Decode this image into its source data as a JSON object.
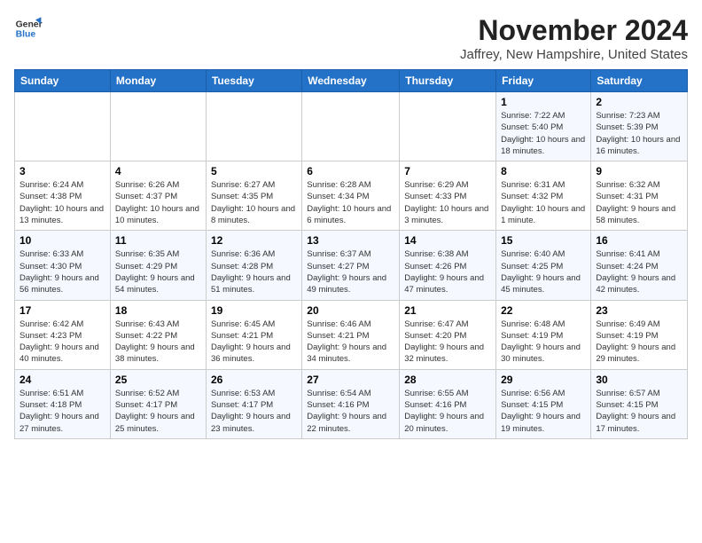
{
  "header": {
    "logo_line1": "General",
    "logo_line2": "Blue",
    "month": "November 2024",
    "location": "Jaffrey, New Hampshire, United States"
  },
  "weekdays": [
    "Sunday",
    "Monday",
    "Tuesday",
    "Wednesday",
    "Thursday",
    "Friday",
    "Saturday"
  ],
  "weeks": [
    [
      {
        "day": "",
        "detail": ""
      },
      {
        "day": "",
        "detail": ""
      },
      {
        "day": "",
        "detail": ""
      },
      {
        "day": "",
        "detail": ""
      },
      {
        "day": "",
        "detail": ""
      },
      {
        "day": "1",
        "detail": "Sunrise: 7:22 AM\nSunset: 5:40 PM\nDaylight: 10 hours and 18 minutes."
      },
      {
        "day": "2",
        "detail": "Sunrise: 7:23 AM\nSunset: 5:39 PM\nDaylight: 10 hours and 16 minutes."
      }
    ],
    [
      {
        "day": "3",
        "detail": "Sunrise: 6:24 AM\nSunset: 4:38 PM\nDaylight: 10 hours and 13 minutes."
      },
      {
        "day": "4",
        "detail": "Sunrise: 6:26 AM\nSunset: 4:37 PM\nDaylight: 10 hours and 10 minutes."
      },
      {
        "day": "5",
        "detail": "Sunrise: 6:27 AM\nSunset: 4:35 PM\nDaylight: 10 hours and 8 minutes."
      },
      {
        "day": "6",
        "detail": "Sunrise: 6:28 AM\nSunset: 4:34 PM\nDaylight: 10 hours and 6 minutes."
      },
      {
        "day": "7",
        "detail": "Sunrise: 6:29 AM\nSunset: 4:33 PM\nDaylight: 10 hours and 3 minutes."
      },
      {
        "day": "8",
        "detail": "Sunrise: 6:31 AM\nSunset: 4:32 PM\nDaylight: 10 hours and 1 minute."
      },
      {
        "day": "9",
        "detail": "Sunrise: 6:32 AM\nSunset: 4:31 PM\nDaylight: 9 hours and 58 minutes."
      }
    ],
    [
      {
        "day": "10",
        "detail": "Sunrise: 6:33 AM\nSunset: 4:30 PM\nDaylight: 9 hours and 56 minutes."
      },
      {
        "day": "11",
        "detail": "Sunrise: 6:35 AM\nSunset: 4:29 PM\nDaylight: 9 hours and 54 minutes."
      },
      {
        "day": "12",
        "detail": "Sunrise: 6:36 AM\nSunset: 4:28 PM\nDaylight: 9 hours and 51 minutes."
      },
      {
        "day": "13",
        "detail": "Sunrise: 6:37 AM\nSunset: 4:27 PM\nDaylight: 9 hours and 49 minutes."
      },
      {
        "day": "14",
        "detail": "Sunrise: 6:38 AM\nSunset: 4:26 PM\nDaylight: 9 hours and 47 minutes."
      },
      {
        "day": "15",
        "detail": "Sunrise: 6:40 AM\nSunset: 4:25 PM\nDaylight: 9 hours and 45 minutes."
      },
      {
        "day": "16",
        "detail": "Sunrise: 6:41 AM\nSunset: 4:24 PM\nDaylight: 9 hours and 42 minutes."
      }
    ],
    [
      {
        "day": "17",
        "detail": "Sunrise: 6:42 AM\nSunset: 4:23 PM\nDaylight: 9 hours and 40 minutes."
      },
      {
        "day": "18",
        "detail": "Sunrise: 6:43 AM\nSunset: 4:22 PM\nDaylight: 9 hours and 38 minutes."
      },
      {
        "day": "19",
        "detail": "Sunrise: 6:45 AM\nSunset: 4:21 PM\nDaylight: 9 hours and 36 minutes."
      },
      {
        "day": "20",
        "detail": "Sunrise: 6:46 AM\nSunset: 4:21 PM\nDaylight: 9 hours and 34 minutes."
      },
      {
        "day": "21",
        "detail": "Sunrise: 6:47 AM\nSunset: 4:20 PM\nDaylight: 9 hours and 32 minutes."
      },
      {
        "day": "22",
        "detail": "Sunrise: 6:48 AM\nSunset: 4:19 PM\nDaylight: 9 hours and 30 minutes."
      },
      {
        "day": "23",
        "detail": "Sunrise: 6:49 AM\nSunset: 4:19 PM\nDaylight: 9 hours and 29 minutes."
      }
    ],
    [
      {
        "day": "24",
        "detail": "Sunrise: 6:51 AM\nSunset: 4:18 PM\nDaylight: 9 hours and 27 minutes."
      },
      {
        "day": "25",
        "detail": "Sunrise: 6:52 AM\nSunset: 4:17 PM\nDaylight: 9 hours and 25 minutes."
      },
      {
        "day": "26",
        "detail": "Sunrise: 6:53 AM\nSunset: 4:17 PM\nDaylight: 9 hours and 23 minutes."
      },
      {
        "day": "27",
        "detail": "Sunrise: 6:54 AM\nSunset: 4:16 PM\nDaylight: 9 hours and 22 minutes."
      },
      {
        "day": "28",
        "detail": "Sunrise: 6:55 AM\nSunset: 4:16 PM\nDaylight: 9 hours and 20 minutes."
      },
      {
        "day": "29",
        "detail": "Sunrise: 6:56 AM\nSunset: 4:15 PM\nDaylight: 9 hours and 19 minutes."
      },
      {
        "day": "30",
        "detail": "Sunrise: 6:57 AM\nSunset: 4:15 PM\nDaylight: 9 hours and 17 minutes."
      }
    ]
  ]
}
